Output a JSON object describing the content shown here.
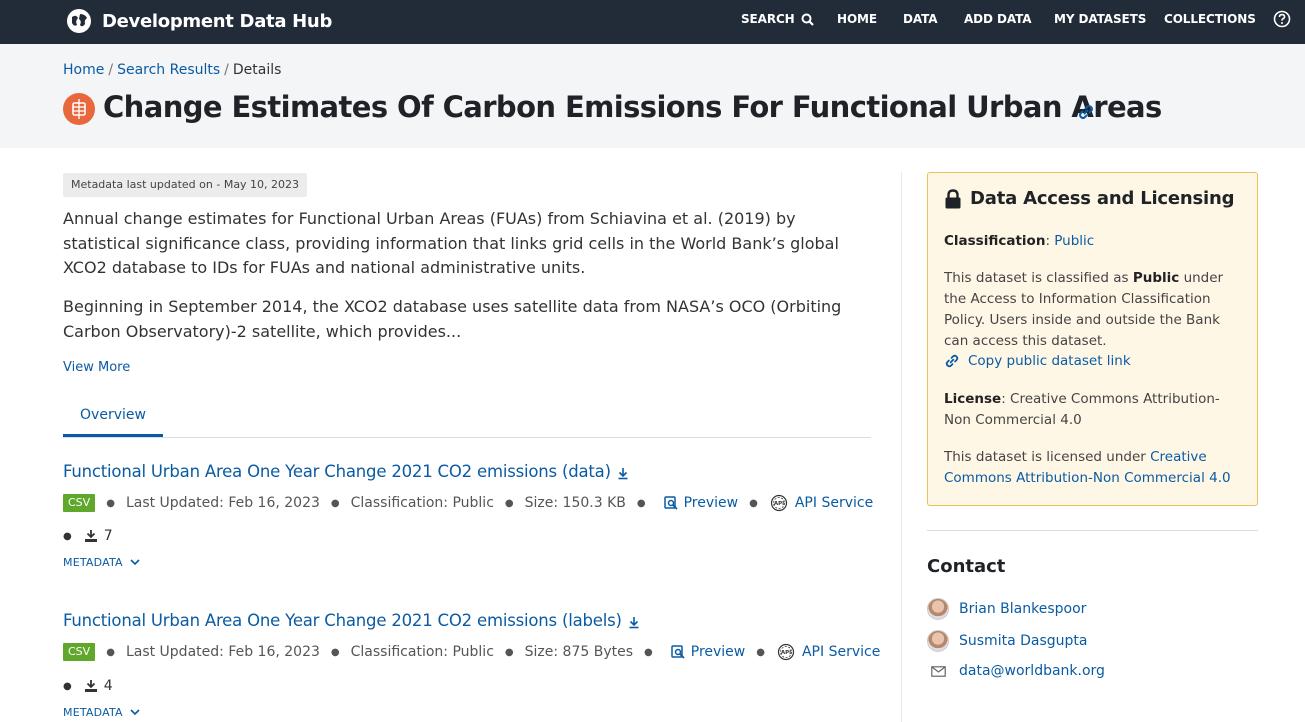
{
  "app": {
    "name": "Development Data Hub"
  },
  "nav": {
    "items": [
      {
        "label": "SEARCH",
        "icon": "search-icon"
      },
      {
        "label": "HOME"
      },
      {
        "label": "DATA"
      },
      {
        "label": "ADD DATA"
      },
      {
        "label": "MY DATASETS"
      },
      {
        "label": "COLLECTIONS"
      }
    ],
    "help_icon": "help-icon"
  },
  "breadcrumb": {
    "home": "Home",
    "search": "Search Results",
    "current": "Details",
    "separator": "/"
  },
  "dataset": {
    "title": "Change Estimates Of Carbon Emissions For Functional Urban Areas",
    "metadata_updated": "Metadata last updated on - May 10, 2023",
    "description": [
      "Annual change estimates for Functional Urban Areas (FUAs) from Schiavina et al. (2019) by statistical significance class, providing information that links grid cells in the World Bank’s global XCO2 database to IDs for FUAs and national administrative units.",
      "Beginning in September 2014, the XCO2 database uses satellite data from NASA’s OCO (Orbiting Carbon Observatory)-2 satellite, which provides..."
    ],
    "view_more": "View More",
    "tab": "Overview"
  },
  "resources": [
    {
      "title": "Functional Urban Area One Year Change 2021 CO2 emissions (data)",
      "format": "CSV",
      "updated_label": "Last Updated:",
      "updated": "Feb 16, 2023",
      "class_label": "Classification:",
      "classification": "Public",
      "size_label": "Size:",
      "size": "150.3 KB",
      "preview": "Preview",
      "api": "API Service",
      "downloads": "7",
      "metadata": "METADATA"
    },
    {
      "title": "Functional Urban Area One Year Change 2021 CO2 emissions (labels)",
      "format": "CSV",
      "updated_label": "Last Updated:",
      "updated": "Feb 16, 2023",
      "class_label": "Classification:",
      "classification": "Public",
      "size_label": "Size:",
      "size": "875 Bytes",
      "preview": "Preview",
      "api": "API Service",
      "downloads": "4",
      "metadata": "METADATA"
    }
  ],
  "access": {
    "title": "Data Access and Licensing",
    "classification_label": "Classification",
    "classification": "Public",
    "class_text_1": "This dataset is classified as",
    "class_text_bold": "Public",
    "class_text_2": "under the Access to Information Classification Policy. Users inside and outside the Bank can access this dataset.",
    "copy_link": "Copy public dataset link",
    "license_label": "License",
    "license": "Creative Commons Attribution-Non Commercial 4.0",
    "license_text": "This dataset is licensed under",
    "license_link": "Creative Commons Attribution-Non Commercial 4.0",
    "accent": "#f0c058"
  },
  "contact": {
    "heading": "Contact",
    "people": [
      "Brian Blankespoor",
      "Susmita Dasgupta"
    ],
    "email": "data@worldbank.org"
  },
  "colors": {
    "nav_bg": "#222b38",
    "link": "#0a5ba3",
    "csv": "#5fa82c",
    "dataset_icon": "#e8673c"
  }
}
